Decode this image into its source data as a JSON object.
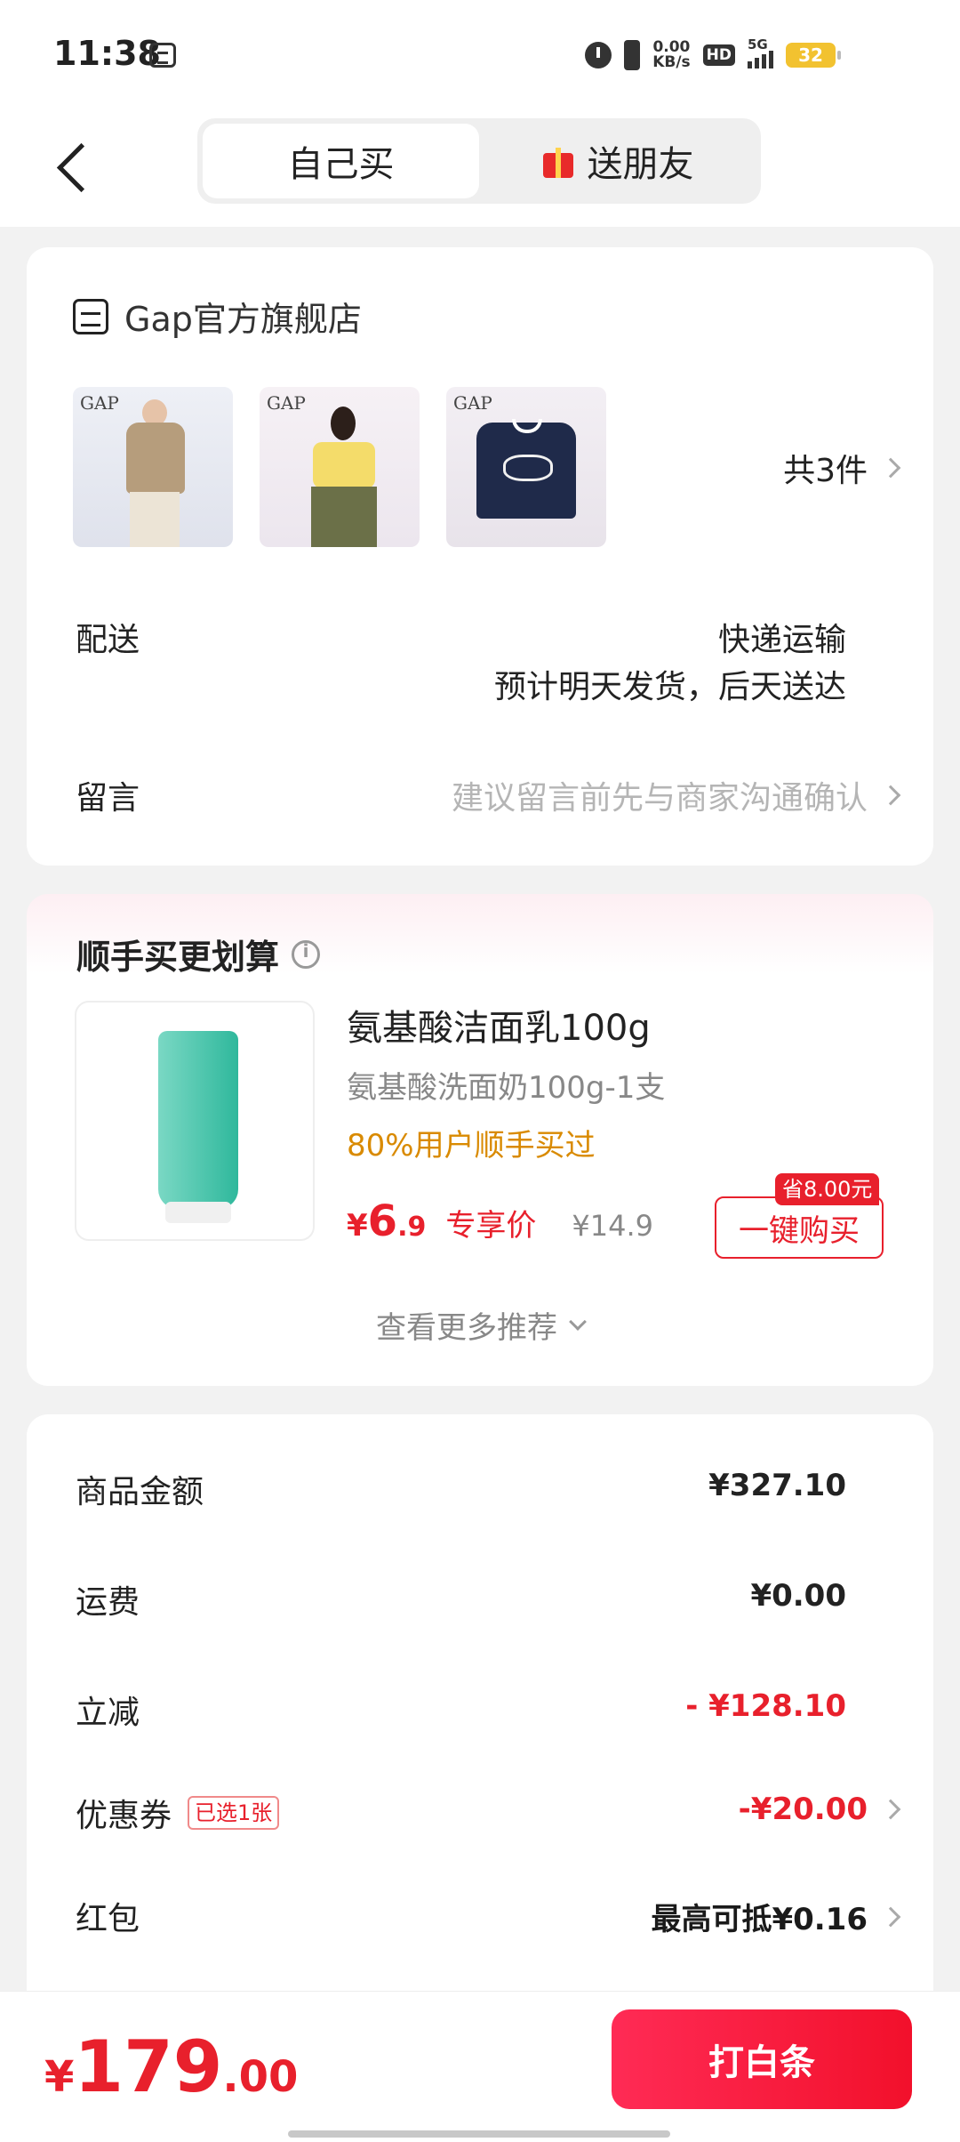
{
  "status_bar": {
    "time": "11:38",
    "net_speed_value": "0.00",
    "net_speed_unit": "KB/s",
    "hd": "HD",
    "network": "5G",
    "battery": "32",
    "icons": [
      "note-icon",
      "alarm-icon",
      "vibrate-icon",
      "signal-icon",
      "battery-icon"
    ]
  },
  "header": {
    "tabs": [
      {
        "label": "自己买",
        "active": true
      },
      {
        "label": "送朋友",
        "active": false
      }
    ]
  },
  "store": {
    "name": "Gap官方旗舰店",
    "thumb_logo": "GAP",
    "item_count": "共3件",
    "shipping_label": "配送",
    "shipping_method": "快递运输",
    "shipping_eta": "预计明天发货，后天送达",
    "message_label": "留言",
    "message_placeholder": "建议留言前先与商家沟通确认"
  },
  "addon": {
    "title": "顺手买更划算",
    "product_name": "氨基酸洁面乳100g",
    "product_spec": "氨基酸洗面奶100g-1支",
    "stat": "80%用户顺手买过",
    "price_symbol": "¥",
    "price_int": "6",
    "price_dec": ".9",
    "price_tag": "专享价",
    "original_price": "¥14.9",
    "buy_label": "一键购买",
    "save_badge": "省8.00元",
    "more_label": "查看更多推荐"
  },
  "price_summary": {
    "goods_label": "商品金额",
    "goods_value": "¥327.10",
    "shipping_label": "运费",
    "shipping_value": "¥0.00",
    "discount_label": "立减",
    "discount_value": "- ¥128.10",
    "coupon_label": "优惠券",
    "coupon_tag": "已选1张",
    "coupon_value": "-¥20.00",
    "redpacket_label": "红包",
    "redpacket_value": "最高可抵¥0.16"
  },
  "bottom": {
    "total_symbol": "¥",
    "total_int": "179",
    "total_dec": ".00",
    "pay_label": "打白条"
  },
  "colors": {
    "accent_red": "#e8202c",
    "stat_orange": "#d98a00",
    "pay_gradient_start": "#ff2b55",
    "pay_gradient_end": "#f2102b"
  }
}
